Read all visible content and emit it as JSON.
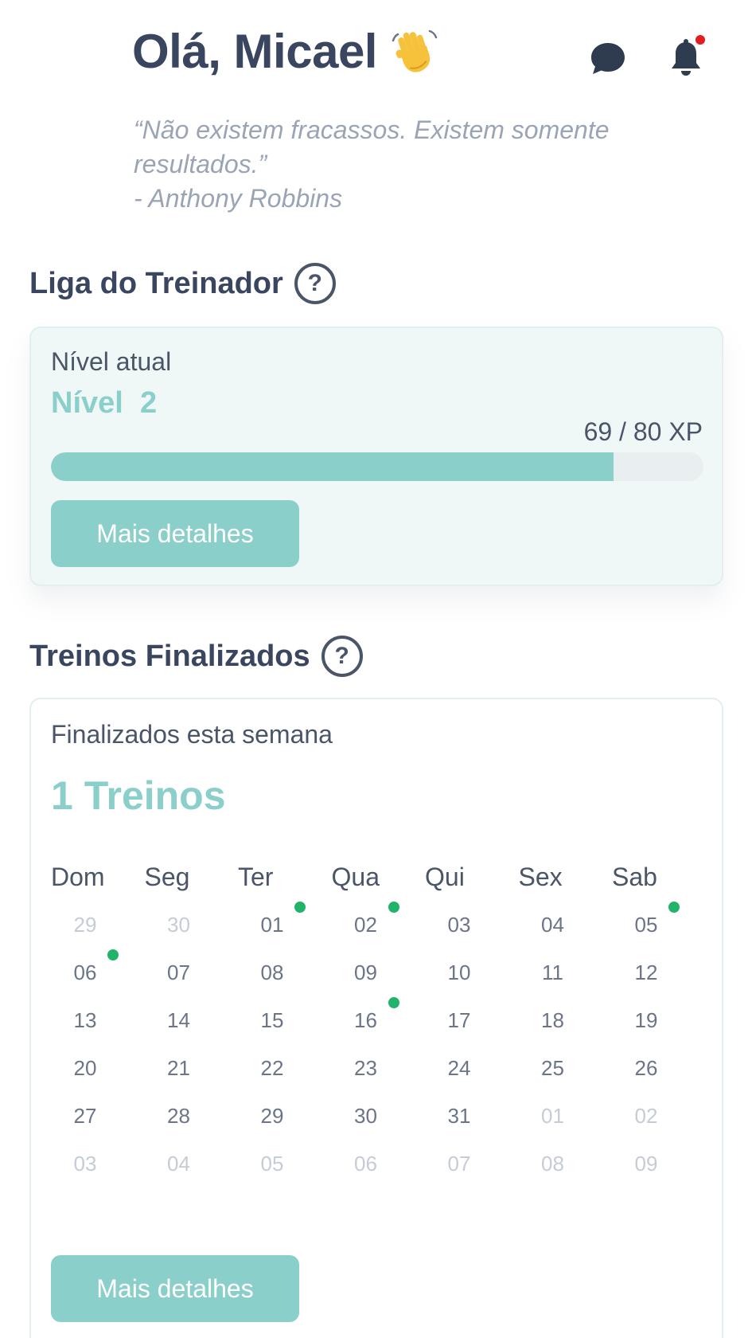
{
  "header": {
    "greeting": "Olá, Micael",
    "quote_line1": "“Não existem fracassos. Existem somente",
    "quote_line2": "resultados.”",
    "quote_author": "- Anthony Robbins",
    "has_notification": true
  },
  "liga": {
    "title": "Liga do Treinador",
    "label": "Nível atual",
    "level": "Nível  2",
    "xp_text": "69 / 80 XP",
    "xp_current": 69,
    "xp_max": 80,
    "button": "Mais detalhes"
  },
  "treinos": {
    "title": "Treinos Finalizados",
    "label": "Finalizados esta semana",
    "count": "1 Treinos",
    "button": "Mais detalhes",
    "weekdays": [
      "Dom",
      "Seg",
      "Ter",
      "Qua",
      "Qui",
      "Sex",
      "Sab"
    ],
    "weeks": [
      [
        {
          "d": "29",
          "m": true
        },
        {
          "d": "30",
          "m": true
        },
        {
          "d": "01",
          "done": true
        },
        {
          "d": "02",
          "done": true
        },
        {
          "d": "03"
        },
        {
          "d": "04"
        },
        {
          "d": "05",
          "done": true
        }
      ],
      [
        {
          "d": "06",
          "done": true
        },
        {
          "d": "07"
        },
        {
          "d": "08"
        },
        {
          "d": "09"
        },
        {
          "d": "10"
        },
        {
          "d": "11"
        },
        {
          "d": "12"
        }
      ],
      [
        {
          "d": "13"
        },
        {
          "d": "14"
        },
        {
          "d": "15"
        },
        {
          "d": "16",
          "done": true
        },
        {
          "d": "17"
        },
        {
          "d": "18"
        },
        {
          "d": "19"
        }
      ],
      [
        {
          "d": "20"
        },
        {
          "d": "21"
        },
        {
          "d": "22"
        },
        {
          "d": "23"
        },
        {
          "d": "24"
        },
        {
          "d": "25"
        },
        {
          "d": "26"
        }
      ],
      [
        {
          "d": "27"
        },
        {
          "d": "28"
        },
        {
          "d": "29"
        },
        {
          "d": "30"
        },
        {
          "d": "31"
        },
        {
          "d": "01",
          "m": true
        },
        {
          "d": "02",
          "m": true
        }
      ],
      [
        {
          "d": "03",
          "m": true
        },
        {
          "d": "04",
          "m": true
        },
        {
          "d": "05",
          "m": true
        },
        {
          "d": "06",
          "m": true
        },
        {
          "d": "07",
          "m": true
        },
        {
          "d": "08",
          "m": true
        },
        {
          "d": "09",
          "m": true
        }
      ]
    ]
  },
  "colors": {
    "accent": "#8bcfcb",
    "done_dot": "#22b36a",
    "notification": "#e11d1d"
  },
  "icons": {
    "chat": "chat-bubble-icon",
    "bell": "bell-icon",
    "help": "help-circle-icon",
    "wave": "waving-hand-icon"
  }
}
